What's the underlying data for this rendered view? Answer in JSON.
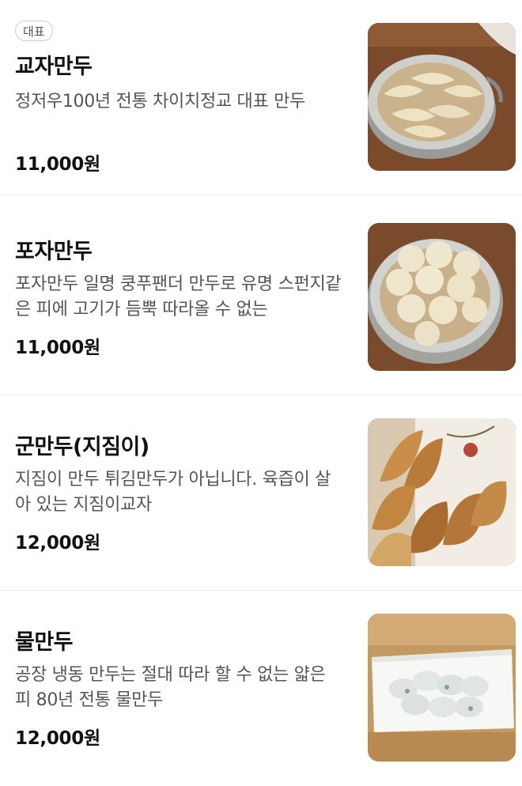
{
  "menu": {
    "items": [
      {
        "badge": "대표",
        "name": "교자만두",
        "description": "정저우100년 전통 차이치정교 대표 만두",
        "price": "11,000원",
        "image": "gyoza-in-steamer-photo"
      },
      {
        "name": "포자만두",
        "description": "포자만두 일명 쿵푸팬더 만두로 유명 스펀지같은 피에 고기가 듬뿍 따라올 수 없는",
        "price": "11,000원",
        "image": "baozi-in-steamer-photo"
      },
      {
        "name": "군만두(지짐이)",
        "description": "지짐이 만두 튀김만두가 아닙니다. 육즙이 살아 있는 지짐이교자",
        "price": "12,000원",
        "image": "pan-fried-dumplings-photo"
      },
      {
        "name": "물만두",
        "description": "공장 냉동 만두는 절대 따라 할 수 없는 얇은 피 80년 전통 물만두",
        "price": "12,000원",
        "image": "boiled-dumplings-plate-photo"
      }
    ]
  },
  "colors": {
    "text_primary": "#111111",
    "text_secondary": "#555555",
    "divider": "#ececec",
    "badge_border": "#cfcfcf"
  }
}
